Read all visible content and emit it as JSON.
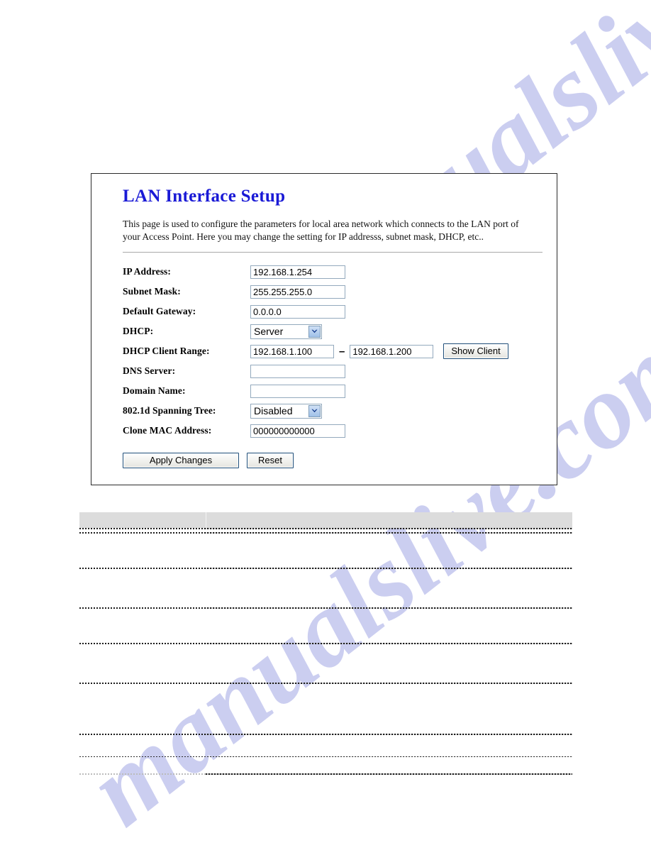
{
  "panel": {
    "title": "LAN Interface Setup",
    "description": "This page is used to configure the parameters for local area network which connects to the LAN port of your Access Point. Here you may change the setting for IP addresss, subnet mask, DHCP, etc..",
    "fields": {
      "ip_address": {
        "label": "IP Address:",
        "value": "192.168.1.254"
      },
      "subnet_mask": {
        "label": "Subnet Mask:",
        "value": "255.255.255.0"
      },
      "default_gateway": {
        "label": "Default Gateway:",
        "value": "0.0.0.0"
      },
      "dhcp": {
        "label": "DHCP:",
        "selected": "Server"
      },
      "dhcp_client_range": {
        "label": "DHCP Client Range:",
        "start": "192.168.1.100",
        "separator": "–",
        "end": "192.168.1.200",
        "show_client_label": "Show Client"
      },
      "dns_server": {
        "label": "DNS Server:",
        "value": "",
        "placeholder": ""
      },
      "domain_name": {
        "label": "Domain Name:",
        "value": "",
        "placeholder": ""
      },
      "spanning_tree": {
        "label": "802.1d Spanning Tree:",
        "selected": "Disabled"
      },
      "clone_mac": {
        "label": "Clone MAC Address:",
        "value": "000000000000"
      }
    },
    "buttons": {
      "apply": "Apply Changes",
      "reset": "Reset"
    }
  },
  "watermark": {
    "text": "manualslive.com"
  },
  "colors": {
    "title_blue": "#1a1ad6",
    "input_border": "#93a9bd",
    "button_border": "#1f4e79",
    "panel_border": "#2b2b2b",
    "watermark": "#c3c6ee",
    "table_header": "#dcdcdc"
  }
}
